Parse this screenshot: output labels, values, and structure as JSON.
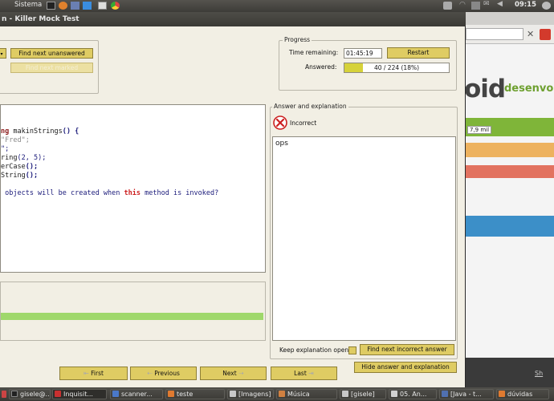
{
  "top_panel": {
    "menu_system": "Sistema",
    "clock": "09:15"
  },
  "window": {
    "title": "n - Killer Mock Test"
  },
  "navigation_group": {
    "find_next_unanswered": "Find next unanswered",
    "find_next_marked": "Find next marked"
  },
  "progress": {
    "legend": "Progress",
    "time_label": "Time remaining:",
    "time_value": "01:45:19",
    "restart": "Restart",
    "answered_label": "Answered:",
    "answered_text": "40 / 224 (18%)",
    "answered_fraction": 0.18
  },
  "question": {
    "line1_kw": "ng",
    "line1_fn": " makinStrings",
    "line1_paren": "()",
    "line1_brace": " {",
    "line2": "\"Fred\";",
    "line3": "\";",
    "line4_a": "ring",
    "line4_b": "(2, 5);",
    "line5_a": "erCase",
    "line5_b": "();",
    "line6_a": "String",
    "line6_b": "();",
    "line7_a": " objects will be created when ",
    "line7_kw": "this",
    "line7_b": " method is invoked?"
  },
  "answer": {
    "legend": "Answer and explanation",
    "status": "Incorrect",
    "explanation": "ops",
    "keep_open_label": "Keep explanation open",
    "find_next_incorrect": "Find next incorrect answer",
    "hide_answer": "Hide answer and explanation"
  },
  "nav_buttons": {
    "first": "First",
    "previous": "Previous",
    "next": "Next",
    "last": "Last"
  },
  "browser": {
    "logo_text": "oid",
    "logo_tail": "desenvolvim",
    "counter": "7,9 mil",
    "footer_link": "Sh"
  },
  "taskbar": {
    "items": [
      {
        "label": "gisele@...",
        "icon_color": "#222222"
      },
      {
        "label": "Inquisit...",
        "icon_color": "#c83030"
      },
      {
        "label": "scanner...",
        "icon_color": "#4a78c8"
      },
      {
        "label": "teste",
        "icon_color": "#e07a30"
      },
      {
        "label": "[Imagens]",
        "icon_color": "#c8c8c8"
      },
      {
        "label": "Música",
        "icon_color": "#d08040"
      },
      {
        "label": "[gisele]",
        "icon_color": "#c8c8c8"
      },
      {
        "label": "05. An...",
        "icon_color": "#d0d0d0"
      },
      {
        "label": "[Java - t...",
        "icon_color": "#5070b0"
      },
      {
        "label": "dúvidas",
        "icon_color": "#e07a30"
      }
    ]
  },
  "colors": {
    "button": "#dfcc63",
    "progress_fill": "#d6d23a",
    "incorrect_red": "#cc1f1f",
    "green_bar": "#9fd86b"
  }
}
